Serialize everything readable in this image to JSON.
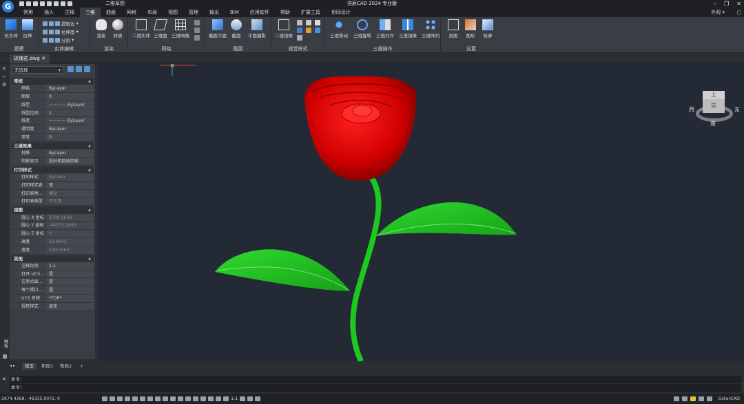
{
  "app": {
    "title": "浩辰CAD 2024 专业版",
    "workspace": "二维草图",
    "appearance": "外观",
    "logo": "G",
    "window_controls": [
      "–",
      "❐",
      "✕"
    ]
  },
  "menu_tabs": [
    "常用",
    "插入",
    "注释",
    "三维",
    "曲面",
    "网格",
    "布局",
    "视图",
    "管理",
    "输出",
    "BIM",
    "应用软件",
    "帮助",
    "扩展工具",
    "协同设计"
  ],
  "active_tab": "三维",
  "ribbon": {
    "modeling": {
      "label": "建模",
      "box": "长方体",
      "extrude": "拉伸"
    },
    "solid_edit": {
      "label": "实体编辑",
      "extract_edges": "提取边",
      "extrude_face": "拉伸面",
      "separate": "分割"
    },
    "render": {
      "label": "渲染",
      "render": "渲染",
      "material": "材质"
    },
    "mesh": {
      "label": "网格",
      "solid2d": "二维实体",
      "surface3d": "三维面",
      "mesh3d": "三维网格"
    },
    "section": {
      "label": "截面",
      "section_plane": "截面平面",
      "section": "截面",
      "flatshot": "平面摄影"
    },
    "visual_style": {
      "label": "视觉样式",
      "wireframe2d": "二维线框"
    },
    "ops3d": {
      "label": "三维操作",
      "move3d": "三维移动",
      "rotate3d": "三维旋转",
      "align3d": "三维对齐",
      "mirror3d": "三维镜像",
      "array3d": "三维阵列"
    },
    "settings": {
      "label": "设置",
      "view": "视图",
      "graphics": "图形",
      "wheel": "轮廓"
    }
  },
  "document": {
    "tab": "玫瑰花.dwg"
  },
  "properties": {
    "selection": "无选择",
    "sections": [
      {
        "title": "常规",
        "rows": [
          {
            "key": "颜色",
            "value": "ByLayer"
          },
          {
            "key": "图层",
            "value": "0"
          },
          {
            "key": "线型",
            "value": "———— ByLayer"
          },
          {
            "key": "线型比例",
            "value": "1"
          },
          {
            "key": "线宽",
            "value": "———— ByLayer"
          },
          {
            "key": "透明度",
            "value": "ByLayer"
          },
          {
            "key": "厚度",
            "value": "0"
          }
        ]
      },
      {
        "title": "三维效果",
        "rows": [
          {
            "key": "材质",
            "value": "ByLayer"
          },
          {
            "key": "阴影显示",
            "value": "投射和接收阴影"
          }
        ]
      },
      {
        "title": "打印样式",
        "rows": [
          {
            "key": "打印样式",
            "value": "ByColor",
            "dim": true
          },
          {
            "key": "打印样式表",
            "value": "无"
          },
          {
            "key": "打印表附…",
            "value": "模型",
            "dim": true
          },
          {
            "key": "打印表类型",
            "value": "不可用",
            "dim": true
          }
        ]
      },
      {
        "title": "视图",
        "rows": [
          {
            "key": "圆心 X 坐标",
            "value": "3709.1639",
            "dim": true
          },
          {
            "key": "圆心 Y 坐标",
            "value": "-46573.2099",
            "dim": true
          },
          {
            "key": "圆心 Z 坐标",
            "value": "0",
            "dim": true
          },
          {
            "key": "高度",
            "value": "52.4603",
            "dim": true
          },
          {
            "key": "宽度",
            "value": "129.0564",
            "dim": true
          }
        ]
      },
      {
        "title": "其他",
        "rows": [
          {
            "key": "注释比例",
            "value": "1:1"
          },
          {
            "key": "打开 UCS…",
            "value": "是"
          },
          {
            "key": "在原点显…",
            "value": "是"
          },
          {
            "key": "每个视口…",
            "value": "是"
          },
          {
            "key": "UCS 名称",
            "value": "*TOP*"
          },
          {
            "key": "视觉样式",
            "value": "真实"
          }
        ]
      }
    ]
  },
  "viewcube": {
    "top": "上",
    "front": "前",
    "west": "西",
    "east": "东",
    "south": "南"
  },
  "colors": {
    "petal": "#d40000",
    "leaf": "#22cc22",
    "viewport_bg": "#232a35"
  },
  "layout_tabs": [
    "模型",
    "布局1",
    "布局2",
    "+"
  ],
  "command": {
    "line1": "命令：",
    "line2": "命令："
  },
  "status": {
    "coords": "2674.4368, -46335.9072, 0",
    "scale": "1:1",
    "brand": "GstarCAD"
  },
  "left_strip_label": "特性"
}
